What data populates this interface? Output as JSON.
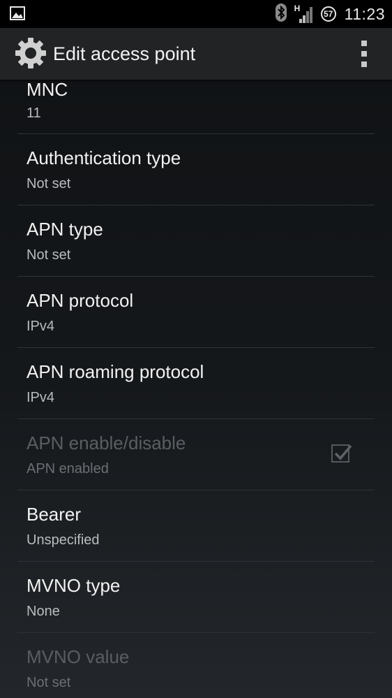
{
  "status_bar": {
    "time": "11:23",
    "battery_level": "57",
    "network_type": "H",
    "icons": [
      "image-notification-icon",
      "bluetooth-icon",
      "signal-icon",
      "battery-icon"
    ]
  },
  "action_bar": {
    "title": "Edit access point",
    "icon": "gear-icon",
    "overflow_icon": "overflow-menu-icon"
  },
  "settings": [
    {
      "label": "MNC",
      "value": "11",
      "enabled": true
    },
    {
      "label": "Authentication type",
      "value": "Not set",
      "enabled": true
    },
    {
      "label": "APN type",
      "value": "Not set",
      "enabled": true
    },
    {
      "label": "APN protocol",
      "value": "IPv4",
      "enabled": true
    },
    {
      "label": "APN roaming protocol",
      "value": "IPv4",
      "enabled": true
    },
    {
      "label": "APN enable/disable",
      "value": "APN enabled",
      "enabled": false,
      "checked": true
    },
    {
      "label": "Bearer",
      "value": "Unspecified",
      "enabled": true
    },
    {
      "label": "MVNO type",
      "value": "None",
      "enabled": true
    },
    {
      "label": "MVNO value",
      "value": "Not set",
      "enabled": false
    }
  ],
  "colors": {
    "action_bar": "#212325",
    "status_bar": "#000000",
    "primary_text": "#f2f2f2",
    "secondary_text": "#b9bcbf",
    "disabled_text": "#5a5e62",
    "divider": "#2e3236"
  }
}
